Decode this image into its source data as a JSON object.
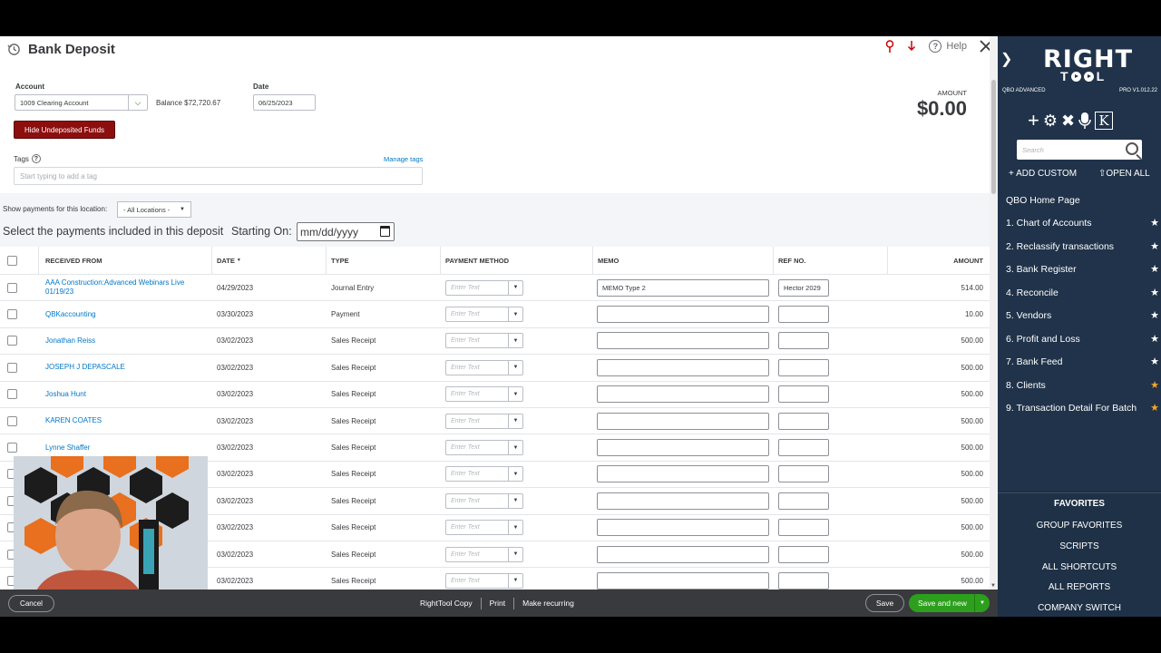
{
  "header": {
    "title": "Bank Deposit",
    "help": "Help"
  },
  "form": {
    "account_label": "Account",
    "account_value": "1009 Clearing Account",
    "balance": "Balance $72,720.67",
    "date_label": "Date",
    "date_value": "06/25/2023",
    "amount_label": "AMOUNT",
    "amount_value": "$0.00",
    "hide_button": "Hide Undeposited Funds",
    "tags_label": "Tags",
    "manage_tags": "Manage tags",
    "tags_placeholder": "Start typing to add a tag"
  },
  "filters": {
    "location_label": "Show payments for this location:",
    "location_value": "- All Locations -",
    "select_label": "Select the payments included in this deposit",
    "starting_on": "Starting On:",
    "date_placeholder": "mm/dd/yyyy"
  },
  "table": {
    "columns": [
      "RECEIVED FROM",
      "DATE",
      "TYPE",
      "PAYMENT METHOD",
      "MEMO",
      "REF NO.",
      "AMOUNT"
    ],
    "method_placeholder": "Enter Text",
    "rows": [
      {
        "from": "AAA Construction:Advanced Webinars Live 01/19/23",
        "date": "04/29/2023",
        "type": "Journal Entry",
        "memo": "MEMO Type 2",
        "ref": "Hector 2029",
        "amount": "514.00"
      },
      {
        "from": "QBKaccounting",
        "date": "03/30/2023",
        "type": "Payment",
        "memo": "",
        "ref": "",
        "amount": "10.00"
      },
      {
        "from": "Jonathan Reiss",
        "date": "03/02/2023",
        "type": "Sales Receipt",
        "memo": "",
        "ref": "",
        "amount": "500.00"
      },
      {
        "from": "JOSEPH J DEPASCALE",
        "date": "03/02/2023",
        "type": "Sales Receipt",
        "memo": "",
        "ref": "",
        "amount": "500.00"
      },
      {
        "from": "Joshua Hunt",
        "date": "03/02/2023",
        "type": "Sales Receipt",
        "memo": "",
        "ref": "",
        "amount": "500.00"
      },
      {
        "from": "KAREN COATES",
        "date": "03/02/2023",
        "type": "Sales Receipt",
        "memo": "",
        "ref": "",
        "amount": "500.00"
      },
      {
        "from": "Lynne Shaffer",
        "date": "03/02/2023",
        "type": "Sales Receipt",
        "memo": "",
        "ref": "",
        "amount": "500.00"
      },
      {
        "from": "",
        "date": "03/02/2023",
        "type": "Sales Receipt",
        "memo": "",
        "ref": "",
        "amount": "500.00"
      },
      {
        "from": "",
        "date": "03/02/2023",
        "type": "Sales Receipt",
        "memo": "",
        "ref": "",
        "amount": "500.00"
      },
      {
        "from": "",
        "date": "03/02/2023",
        "type": "Sales Receipt",
        "memo": "",
        "ref": "",
        "amount": "500.00"
      },
      {
        "from": "",
        "date": "03/02/2023",
        "type": "Sales Receipt",
        "memo": "",
        "ref": "",
        "amount": "500.00"
      },
      {
        "from": "",
        "date": "03/02/2023",
        "type": "Sales Receipt",
        "memo": "",
        "ref": "",
        "amount": "500.00"
      }
    ]
  },
  "footer": {
    "cancel": "Cancel",
    "righttool_copy": "RightTool Copy",
    "print": "Print",
    "make_recurring": "Make recurring",
    "save": "Save",
    "save_and_new": "Save and new"
  },
  "sidebar": {
    "logo_top": "RIGHT",
    "logo_t": "T",
    "logo_l": "L",
    "edition": "QBO ADVANCED",
    "version": "PRO V1.012.22",
    "search_placeholder": "Search",
    "add_custom": "+ ADD CUSTOM",
    "open_all": "⇧OPEN ALL",
    "home": "QBO Home Page",
    "items": [
      {
        "label": "1. Chart of Accounts",
        "star": "white"
      },
      {
        "label": "2. Reclassify transactions",
        "star": "white"
      },
      {
        "label": "3. Bank Register",
        "star": "white"
      },
      {
        "label": "4. Reconcile",
        "star": "white"
      },
      {
        "label": "5. Vendors",
        "star": "white"
      },
      {
        "label": "6. Profit and Loss",
        "star": "white"
      },
      {
        "label": "7. Bank Feed",
        "star": "white"
      },
      {
        "label": "8. Clients",
        "star": "orange"
      },
      {
        "label": "9. Transaction Detail For Batch",
        "star": "orange"
      }
    ],
    "favorites": {
      "title": "FAVORITES",
      "items": [
        "GROUP FAVORITES",
        "SCRIPTS",
        "ALL SHORTCUTS",
        "ALL REPORTS",
        "COMPANY SWITCH"
      ]
    }
  },
  "colors": {
    "hide_button_bg": "#8d0e0e",
    "save_new_green": "#2ca01c",
    "link_blue": "#0077c5",
    "sidebar_bg": "#20334a",
    "star_orange": "#f5a623"
  }
}
